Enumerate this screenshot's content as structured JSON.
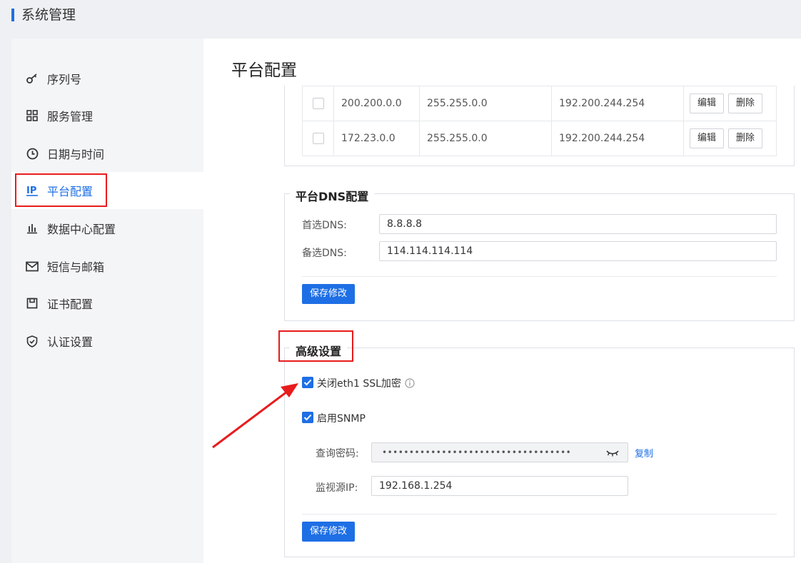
{
  "header": {
    "title": "系统管理"
  },
  "sidebar": {
    "items": [
      {
        "label": "序列号",
        "icon": "key-icon"
      },
      {
        "label": "服务管理",
        "icon": "grid-icon"
      },
      {
        "label": "日期与时间",
        "icon": "clock-icon"
      },
      {
        "label": "平台配置",
        "icon": "ip-icon",
        "active": true
      },
      {
        "label": "数据中心配置",
        "icon": "bar-chart-icon"
      },
      {
        "label": "短信与邮箱",
        "icon": "mail-icon"
      },
      {
        "label": "证书配置",
        "icon": "certificate-icon"
      },
      {
        "label": "认证设置",
        "icon": "shield-icon"
      }
    ]
  },
  "main": {
    "title": "平台配置",
    "routes": {
      "rows": [
        {
          "network": "200.200.0.0",
          "mask": "255.255.0.0",
          "gateway": "192.200.244.254"
        },
        {
          "network": "172.23.0.0",
          "mask": "255.255.0.0",
          "gateway": "192.200.244.254"
        }
      ],
      "edit_label": "编辑",
      "delete_label": "删除"
    },
    "dns": {
      "legend": "平台DNS配置",
      "primary_label": "首选DNS:",
      "primary_value": "8.8.8.8",
      "secondary_label": "备选DNS:",
      "secondary_value": "114.114.114.114",
      "save_label": "保存修改"
    },
    "advanced": {
      "legend": "高级设置",
      "ssl_label": "关闭eth1 SSL加密",
      "ssl_checked": true,
      "snmp_label": "启用SNMP",
      "snmp_checked": true,
      "query_pwd_label": "查询密码:",
      "query_pwd_value": "•••••••••••••••••••••••••••••••••••",
      "copy_label": "复制",
      "monitor_ip_label": "监视源IP:",
      "monitor_ip_value": "192.168.1.254",
      "save_label": "保存修改"
    }
  },
  "colors": {
    "accent": "#1e6fe5",
    "highlight": "#e81c1c"
  }
}
